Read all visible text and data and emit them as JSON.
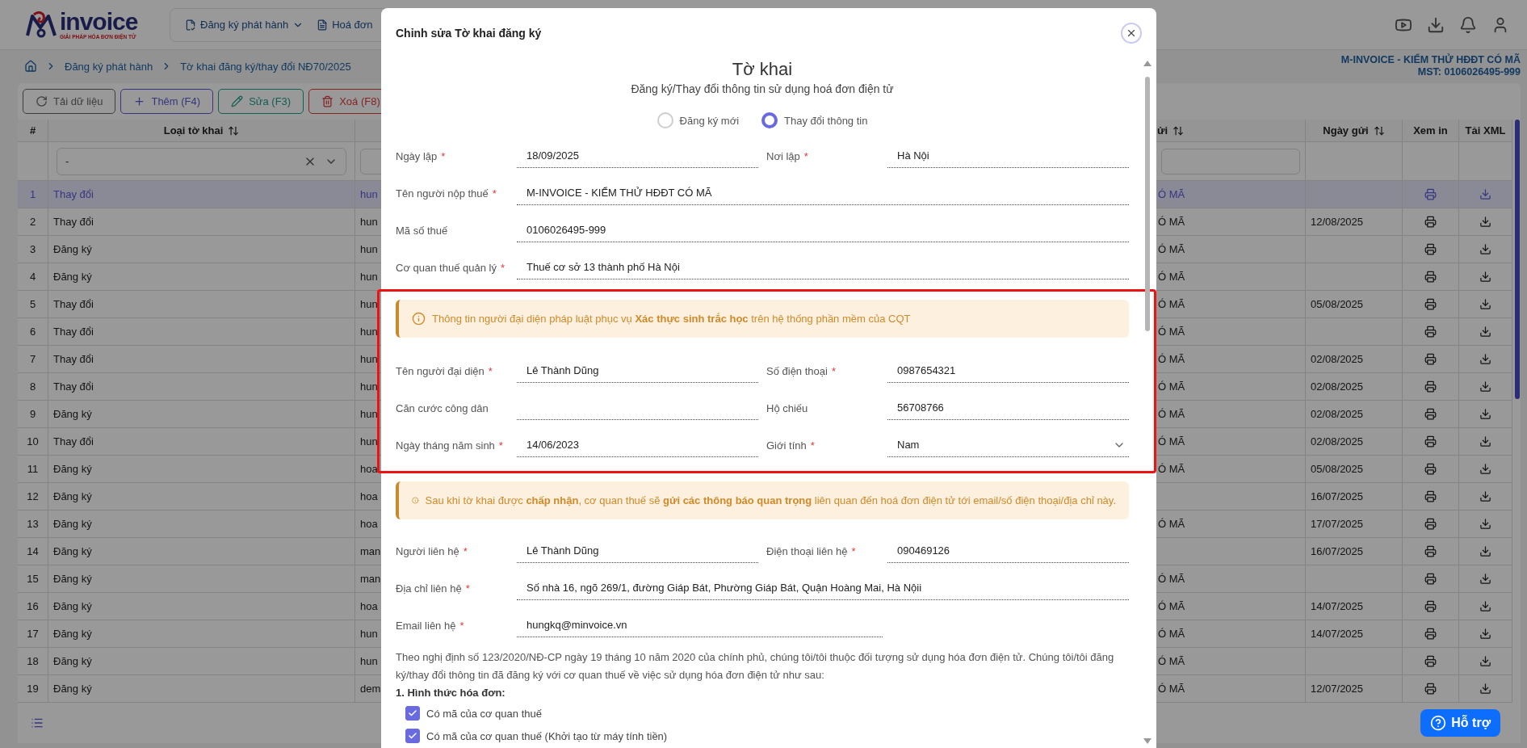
{
  "header": {
    "logo": {
      "name": "invoice",
      "tagline": "GIẢI PHÁP HÓA ĐƠN ĐIỆN TỬ"
    },
    "nav": [
      {
        "label": "Đăng ký phát hành",
        "dropdown": true
      },
      {
        "label": "Hoá đơn",
        "dropdown": false
      }
    ]
  },
  "breadcrumb": [
    "Đăng ký phát hành",
    "Tờ khai đăng ký/thay đổi NĐ70/2025"
  ],
  "company": {
    "name": "M-INVOICE - KIỂM THỬ HĐĐT CÓ MÃ",
    "tax_code": "MST: 0106026495-999"
  },
  "toolbar": [
    {
      "label": "Tải dữ liệu",
      "kind": "reload"
    },
    {
      "label": "Thêm (F4)",
      "kind": "add"
    },
    {
      "label": "Sửa (F3)",
      "kind": "edit"
    },
    {
      "label": "Xoá (F8)",
      "kind": "delete"
    }
  ],
  "table": {
    "columns": [
      {
        "label": "#",
        "sortable": false
      },
      {
        "label": "Loại tờ khai",
        "sortable": true
      },
      {
        "label": "ửi",
        "sortable": true
      },
      {
        "label": "Ngày gửi",
        "sortable": true
      },
      {
        "label": "Xem in",
        "sortable": false
      },
      {
        "label": "Tải XML",
        "sortable": false
      }
    ],
    "filter": {
      "value": "-"
    },
    "rows": [
      {
        "no": "1",
        "type": "Thay đổi",
        "column_3": "hun",
        "column_4": "Ó MÃ",
        "selected": true
      },
      {
        "no": "2",
        "type": "Thay đổi",
        "column_3": "hun",
        "column_4": "Ó MÃ",
        "sent_date": "12/08/2025",
        "selected": false
      },
      {
        "no": "3",
        "type": "Đăng ký",
        "column_3": "hun",
        "column_4": "Ó MÃ",
        "selected": false
      },
      {
        "no": "4",
        "type": "Đăng ký",
        "column_3": "hun",
        "column_4": "Ó MÃ",
        "selected": false
      },
      {
        "no": "5",
        "type": "Thay đổi",
        "column_3": "hun",
        "column_4": "Ó MÃ",
        "sent_date": "05/08/2025",
        "selected": false
      },
      {
        "no": "6",
        "type": "Thay đổi",
        "column_3": "hun",
        "column_4": "Ó MÃ",
        "selected": false
      },
      {
        "no": "7",
        "type": "Thay đổi",
        "column_3": "hun",
        "column_4": "Ó MÃ",
        "sent_date": "02/08/2025",
        "selected": false
      },
      {
        "no": "8",
        "type": "Thay đổi",
        "column_3": "hun",
        "column_4": "Ó MÃ",
        "sent_date": "02/08/2025",
        "selected": false
      },
      {
        "no": "9",
        "type": "Đăng ký",
        "column_3": "hun",
        "column_4": "Ó MÃ",
        "sent_date": "02/08/2025",
        "selected": false
      },
      {
        "no": "10",
        "type": "Thay đổi",
        "column_3": "hun",
        "column_4": "Ó MÃ",
        "sent_date": "02/08/2025",
        "selected": false
      },
      {
        "no": "11",
        "type": "Đăng ký",
        "column_3": "hoa",
        "column_4": "Ó MÃ",
        "sent_date": "05/08/2025",
        "selected": false
      },
      {
        "no": "12",
        "type": "Đăng ký",
        "column_3": "hoa",
        "sent_date": "16/07/2025",
        "selected": false
      },
      {
        "no": "13",
        "type": "Đăng ký",
        "column_3": "hoa",
        "column_4": "Ó MÃ",
        "sent_date": "17/07/2025",
        "selected": false
      },
      {
        "no": "14",
        "type": "Đăng ký",
        "column_3": "man",
        "sent_date": "16/07/2025",
        "selected": false
      },
      {
        "no": "15",
        "type": "Đăng ký",
        "column_3": "man",
        "column_4": "Ó MÃ",
        "selected": false
      },
      {
        "no": "16",
        "type": "Đăng ký",
        "column_3": "hoa",
        "column_4": "Ó MÃ",
        "sent_date": "14/07/2025",
        "selected": false
      },
      {
        "no": "17",
        "type": "Đăng ký",
        "column_3": "hun",
        "column_4": "Ó MÃ",
        "sent_date": "14/07/2025",
        "selected": false
      },
      {
        "no": "18",
        "type": "Đăng ký",
        "column_3": "hun",
        "column_4": "Ó MÃ",
        "selected": false
      },
      {
        "no": "19",
        "type": "Đăng ký",
        "column_3": "dem",
        "column_4": "Ó MÃ",
        "sent_date": "12/07/2025",
        "selected": false
      }
    ]
  },
  "modal": {
    "title": "Chỉnh sửa Tờ khai đăng ký",
    "heading": "Tờ khai",
    "subheading": "Đăng ký/Thay đổi thông tin sử dụng hoá đơn điện tử",
    "required_mark": "*",
    "options": [
      {
        "label": "Đăng ký mới",
        "selected": false
      },
      {
        "label": "Thay đổi thông tin",
        "selected": true
      }
    ],
    "sections": [
      {
        "highlighted": false,
        "rows": [
          [
            {
              "label": "Ngày lập",
              "required": true,
              "value": "18/09/2025",
              "kind": "text"
            },
            {
              "label": "Nơi lập",
              "required": true,
              "value": "Hà Nội",
              "kind": "text"
            }
          ],
          [
            {
              "label": "Tên người nộp thuế",
              "required": true,
              "value": "M-INVOICE - KIỂM THỬ HĐĐT CÓ MÃ",
              "kind": "text"
            }
          ],
          [
            {
              "label": "Mã số thuế",
              "required": false,
              "value": "0106026495-999",
              "kind": "text"
            }
          ],
          [
            {
              "label": "Cơ quan thuế quản lý",
              "required": true,
              "value": "Thuế cơ sở 13 thành phố Hà Nội",
              "kind": "text"
            }
          ]
        ]
      },
      {
        "highlighted": true,
        "notice": "Thông tin người đại diện pháp luật phục vụ **Xác thực sinh trắc học** trên hệ thống phần mềm của CQT",
        "rows": [
          [
            {
              "label": "Tên người đại diện",
              "required": true,
              "value": "Lê Thành Dũng",
              "kind": "text"
            },
            {
              "label": "Số điện thoại",
              "required": true,
              "value": "0987654321",
              "kind": "text"
            }
          ],
          [
            {
              "label": "Căn cước công dân",
              "required": false,
              "kind": "text"
            },
            {
              "label": "Hộ chiếu",
              "required": false,
              "value": "56708766",
              "kind": "text"
            }
          ],
          [
            {
              "label": "Ngày tháng năm sinh",
              "required": true,
              "value": "14/06/2023",
              "kind": "text"
            },
            {
              "label": "Giới tính",
              "required": true,
              "value": "Nam",
              "kind": "select"
            }
          ]
        ]
      },
      {
        "highlighted": false,
        "notice": "Sau khi tờ khai được **chấp nhận**, cơ quan thuế sẽ **gửi các thông báo quan trọng** liên quan đến hoá đơn điện tử tới email/số điện thoại/địa chỉ này.",
        "rows": [
          [
            {
              "label": "Người liên hệ",
              "required": true,
              "value": "Lê Thành Dũng",
              "kind": "text"
            },
            {
              "label": "Điện thoại liên hệ",
              "required": true,
              "value": "090469126",
              "kind": "text"
            }
          ],
          [
            {
              "label": "Địa chỉ liên hệ",
              "required": true,
              "value": "Số nhà 16, ngõ 269/1, đường Giáp Bát, Phường Giáp Bát, Quận Hoàng Mai, Hà Nộii",
              "kind": "text"
            }
          ],
          [
            {
              "label": "Email liên hệ",
              "required": true,
              "value": "hungkq@minvoice.vn",
              "kind": "short"
            }
          ]
        ]
      }
    ],
    "paragraph": "Theo nghị định số 123/2020/NĐ-CP ngày 19 tháng 10 năm 2020 của chính phủ, chúng tôi/tôi thuộc đối tượng sử dụng hóa đơn điện tử. Chúng tôi/tôi đăng ký/thay đổi thông tin đã đăng ký với cơ quan thuế về việc sử dụng hóa đơn điện tử như sau:",
    "subsection": "1. Hình thức hóa đơn:",
    "checkboxes": [
      {
        "label": "Có mã của cơ quan thuế",
        "checked": true
      },
      {
        "label": "Có mã của cơ quan thuế (Khởi tạo từ máy tính tiền)",
        "checked": true
      }
    ]
  },
  "help_button": {
    "label": "Hỗ trợ"
  }
}
